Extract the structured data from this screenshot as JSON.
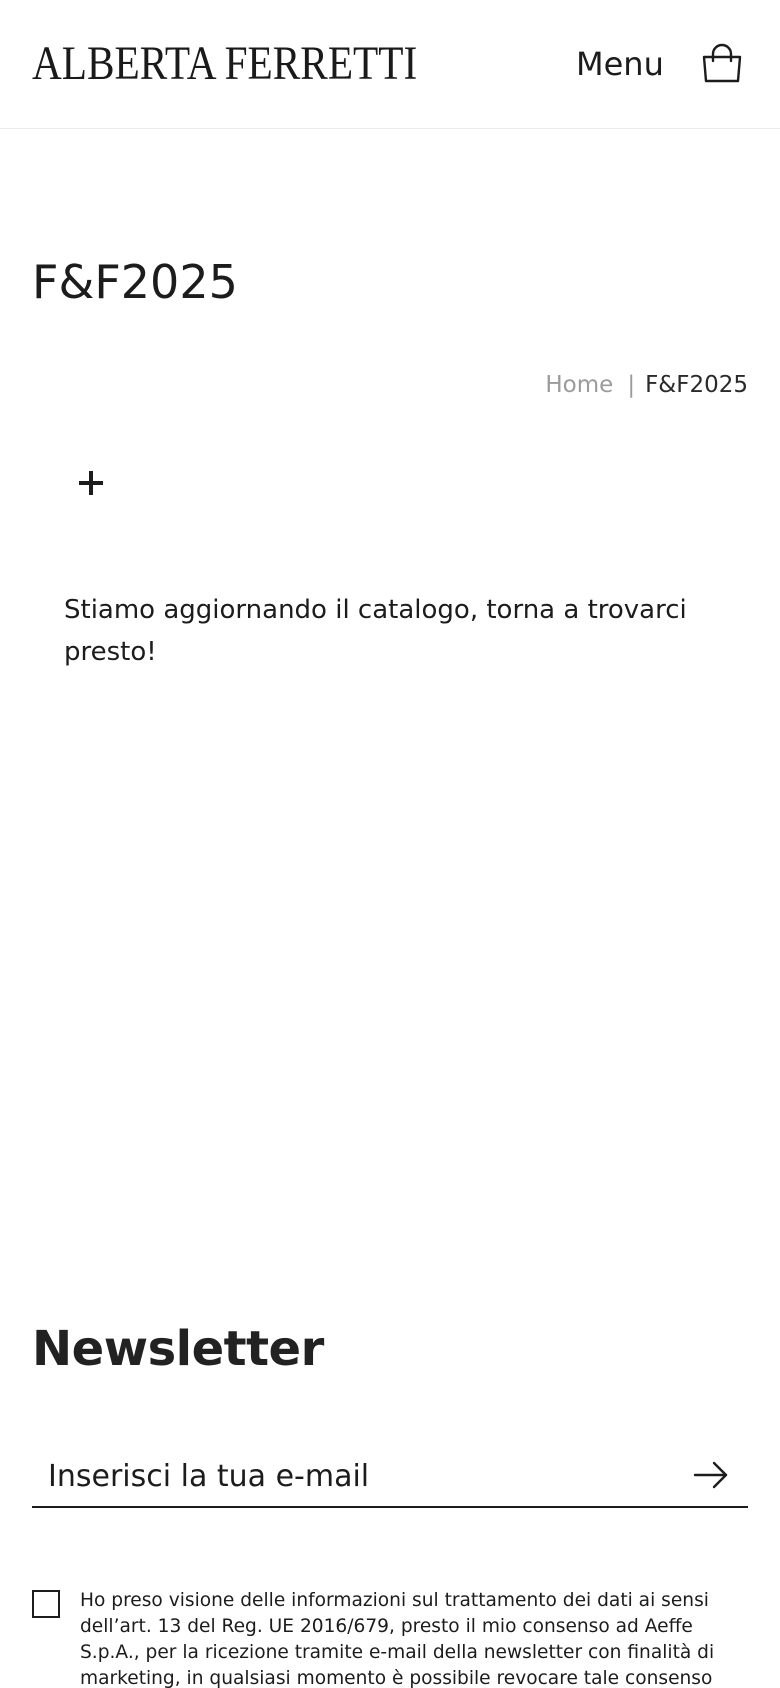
{
  "header": {
    "logo_text": "ALBERTA FERRETTI",
    "menu_label": "Menu",
    "bag_icon": "shopping-bag-icon"
  },
  "page": {
    "title": "F&F2025",
    "breadcrumb": {
      "home": "Home",
      "separator": "|",
      "current": "F&F2025"
    },
    "filter_toggle_icon": "plus-icon",
    "empty_message": "Stiamo aggiornando il catalogo, torna a trovarci presto!"
  },
  "newsletter": {
    "title": "Newsletter",
    "email_placeholder": "Inserisci la tua e-mail",
    "submit_icon": "arrow-right-icon",
    "consent_text": "Ho preso visione delle informazioni sul trattamento dei dati ai sensi dell’art. 13 del Reg. UE 2016/679, presto il mio consenso ad Aeffe S.p.A., per la ricezione tramite e-mail della newsletter con finalità di marketing, in qualsiasi momento è possibile revocare tale consenso con le modalità"
  },
  "colors": {
    "text": "#1c1c1c",
    "muted": "#9b9b9b",
    "divider": "#ececec",
    "background": "#ffffff"
  }
}
